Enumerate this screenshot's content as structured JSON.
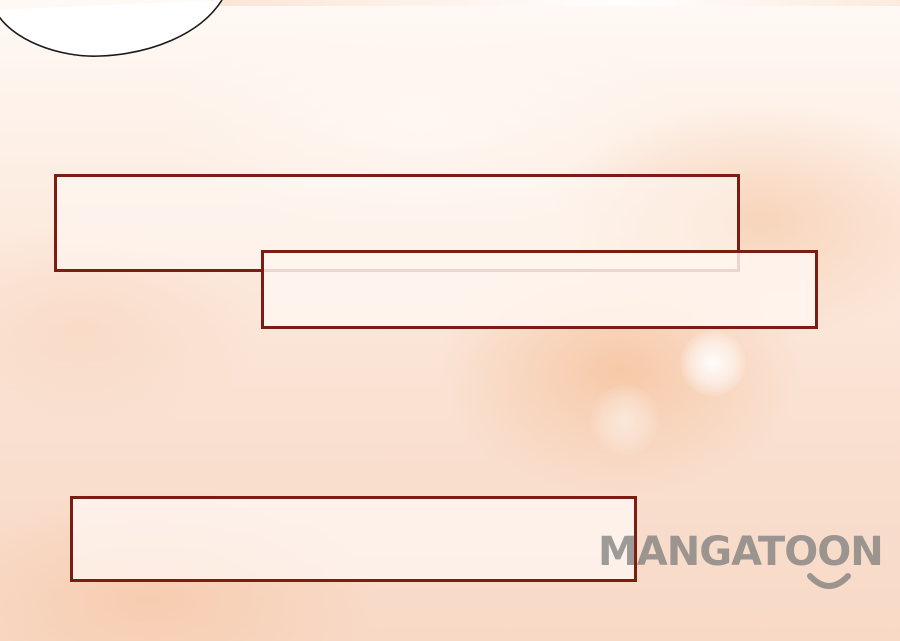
{
  "watermark": {
    "text": "MANGATOON"
  },
  "colors": {
    "box_border": "#7a1d12",
    "background_peach": "#f9dfcf",
    "watermark_gray": "#7c7c7c"
  },
  "icons": {
    "bubble": "speech-bubble-edge",
    "smile": "smile-curve-icon"
  }
}
